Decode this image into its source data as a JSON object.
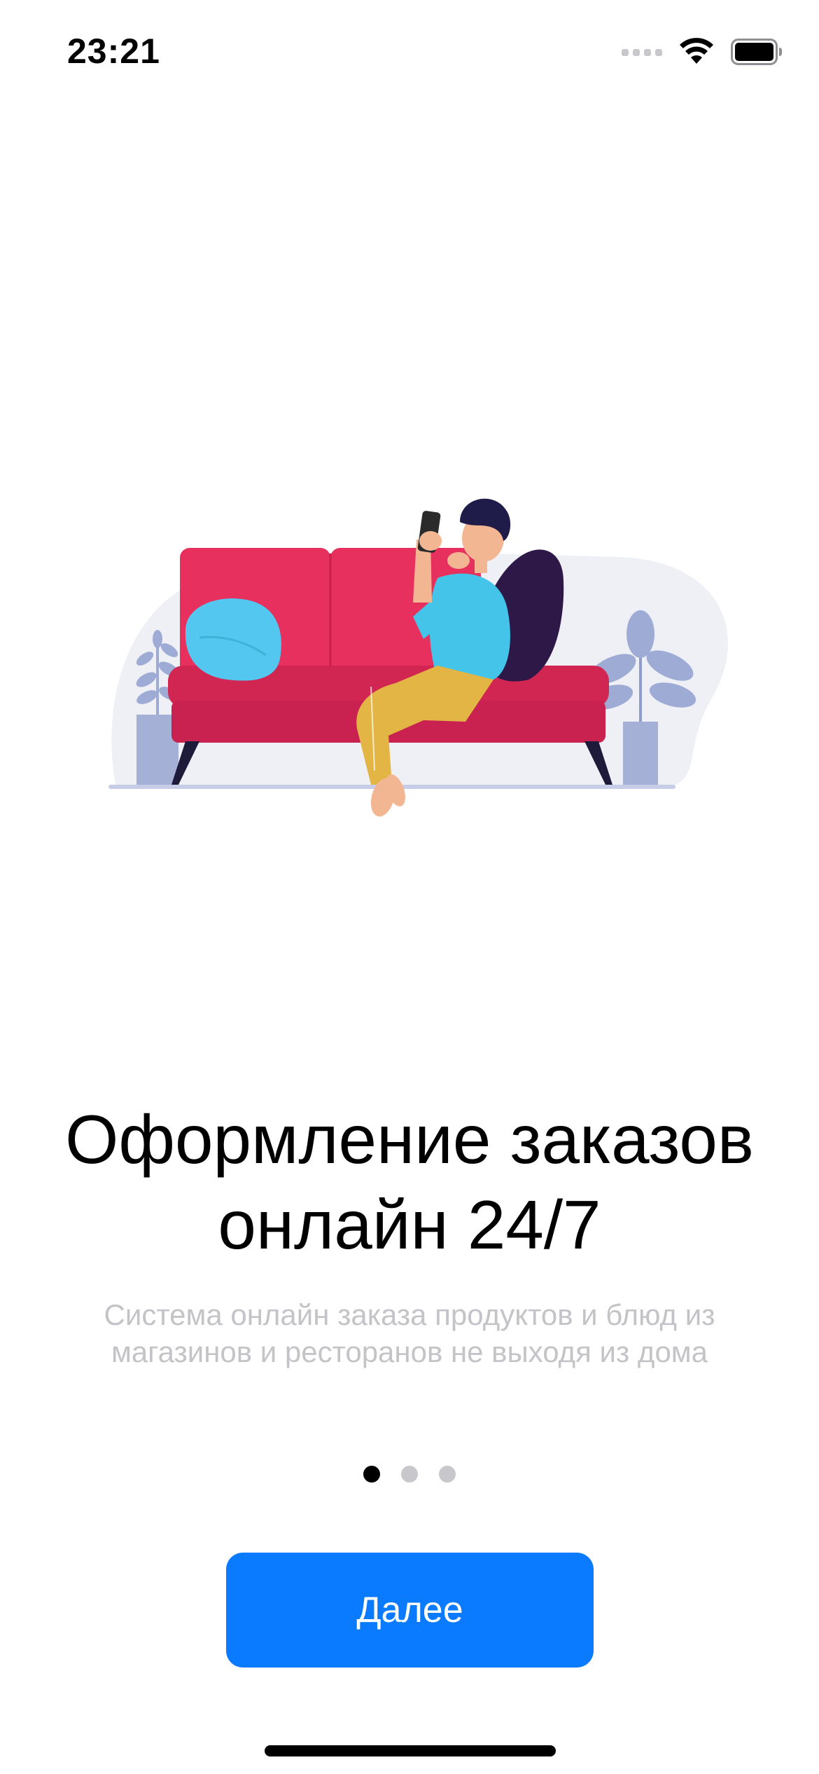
{
  "status_bar": {
    "time": "23:21",
    "icons": [
      "signal-icon",
      "wifi-icon",
      "battery-icon"
    ]
  },
  "illustration": {
    "subject": "man-on-sofa-with-phone",
    "colors": {
      "backdrop": "#eef0f6",
      "sofa": "#e8305e",
      "sofa_dark": "#d12552",
      "pillow": "#53c7ef",
      "pillow_dark": "#2e1848",
      "shirt": "#45c4ea",
      "pants": "#e2b544",
      "skin": "#f3b693",
      "hair": "#1f1c4a",
      "plant": "#9eabd5",
      "pot": "#a4b0d6",
      "floor": "#c7cde6"
    }
  },
  "onboarding": {
    "title_line1": "Оформление заказов",
    "title_line2": "онлайн 24/7",
    "subtitle_line1": "Система онлайн заказа продуктов и блюд из",
    "subtitle_line2": "магазинов и ресторанов не выходя из дома",
    "pages_total": 3,
    "current_page": 1
  },
  "actions": {
    "next_label": "Далее"
  },
  "colors": {
    "accent": "#0a7aff",
    "dot_active": "#000000",
    "dot_inactive": "#c7c7cc",
    "subtitle": "#c4c4c8"
  }
}
